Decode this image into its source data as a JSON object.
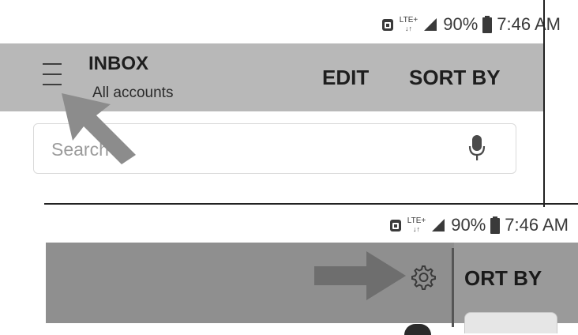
{
  "status_bar": {
    "network": "LTE+",
    "battery": "90%",
    "time": "7:46 AM"
  },
  "toolbar": {
    "title": "INBOX",
    "subtitle": "All accounts",
    "edit_label": "EDIT",
    "sort_label": "SORT BY"
  },
  "search": {
    "placeholder": "Search"
  },
  "zoomed": {
    "sort_partial_label": "ORT BY"
  },
  "colors": {
    "toolbar_bg": "#b8b8b8",
    "zoomed_toolbar_bg": "#8f8f8f",
    "arrow": "#8c8c8c"
  },
  "icons": {
    "menu": "hamburger-menu-icon",
    "mic": "microphone-icon",
    "settings": "gear-icon",
    "signal": "signal-bars-icon",
    "battery": "battery-icon",
    "alarm": "alarm-icon"
  }
}
